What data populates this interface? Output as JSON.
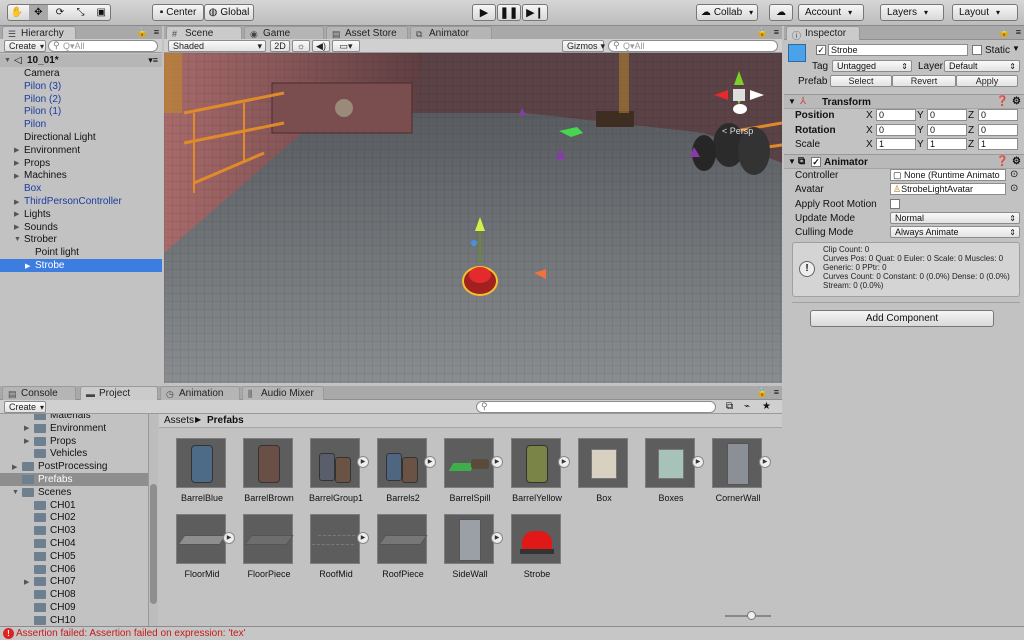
{
  "toolbar": {
    "pivot_center": "Center",
    "pivot_global": "Global",
    "collab": "Collab",
    "account": "Account",
    "layers": "Layers",
    "layout": "Layout"
  },
  "hierarchy": {
    "tab": "Hierarchy",
    "create": "Create",
    "search_placeholder": "Q▾All",
    "scene": "10_01*",
    "items": [
      {
        "label": "Camera",
        "indent": 1,
        "blue": false,
        "arrow": false
      },
      {
        "label": "Pilon (3)",
        "indent": 1,
        "blue": true,
        "arrow": false
      },
      {
        "label": "Pilon (2)",
        "indent": 1,
        "blue": true,
        "arrow": false
      },
      {
        "label": "Pilon (1)",
        "indent": 1,
        "blue": true,
        "arrow": false
      },
      {
        "label": "Pilon",
        "indent": 1,
        "blue": true,
        "arrow": false
      },
      {
        "label": "Directional Light",
        "indent": 1,
        "blue": false,
        "arrow": false
      },
      {
        "label": "Environment",
        "indent": 1,
        "blue": false,
        "arrow": "right"
      },
      {
        "label": "Props",
        "indent": 1,
        "blue": false,
        "arrow": "right"
      },
      {
        "label": "Machines",
        "indent": 1,
        "blue": false,
        "arrow": "right"
      },
      {
        "label": "Box",
        "indent": 1,
        "blue": true,
        "arrow": false
      },
      {
        "label": "ThirdPersonController",
        "indent": 1,
        "blue": true,
        "arrow": "right"
      },
      {
        "label": "Lights",
        "indent": 1,
        "blue": false,
        "arrow": "right"
      },
      {
        "label": "Sounds",
        "indent": 1,
        "blue": false,
        "arrow": "right"
      },
      {
        "label": "Strober",
        "indent": 1,
        "blue": false,
        "arrow": "down"
      },
      {
        "label": "Point light",
        "indent": 2,
        "blue": false,
        "arrow": false
      },
      {
        "label": "Strobe",
        "indent": 2,
        "blue": false,
        "arrow": "right",
        "selected": true
      }
    ]
  },
  "scene": {
    "tabs": [
      "Scene",
      "Game",
      "Asset Store",
      "Animator"
    ],
    "shading": "Shaded",
    "mode2d": "2D",
    "gizmos": "Gizmos",
    "search_placeholder": "Q▾All",
    "persp": "< Persp"
  },
  "inspector": {
    "tab": "Inspector",
    "object_name": "Strobe",
    "static_label": "Static",
    "tag_label": "Tag",
    "tag_value": "Untagged",
    "layer_label": "Layer",
    "layer_value": "Default",
    "prefab_label": "Prefab",
    "prefab_select": "Select",
    "prefab_revert": "Revert",
    "prefab_apply": "Apply",
    "transform": {
      "title": "Transform",
      "position_label": "Position",
      "rotation_label": "Rotation",
      "scale_label": "Scale",
      "position": {
        "x": "0",
        "y": "0",
        "z": "0"
      },
      "rotation": {
        "x": "0",
        "y": "0",
        "z": "0"
      },
      "scale": {
        "x": "1",
        "y": "1",
        "z": "1"
      }
    },
    "animator": {
      "title": "Animator",
      "controller_label": "Controller",
      "controller_value": "None (Runtime Animato",
      "avatar_label": "Avatar",
      "avatar_value": "StrobeLightAvatar",
      "root_motion_label": "Apply Root Motion",
      "update_mode_label": "Update Mode",
      "update_mode_value": "Normal",
      "culling_label": "Culling Mode",
      "culling_value": "Always Animate",
      "info": [
        "Clip Count: 0",
        "Curves Pos: 0 Quat: 0 Euler: 0 Scale: 0 Muscles: 0",
        "Generic: 0 PPtr: 0",
        "Curves Count: 0 Constant: 0 (0.0%) Dense: 0 (0.0%)",
        "Stream: 0 (0.0%)"
      ]
    },
    "add_component": "Add Component"
  },
  "bottom": {
    "tabs": [
      "Console",
      "Project",
      "Animation",
      "Audio Mixer"
    ],
    "create": "Create",
    "breadcrumb_root": "Assets",
    "breadcrumb_current": "Prefabs",
    "tree": [
      {
        "label": "Materials",
        "indent": 2,
        "arrow": false
      },
      {
        "label": "Environment",
        "indent": 2,
        "arrow": "right"
      },
      {
        "label": "Props",
        "indent": 2,
        "arrow": "right"
      },
      {
        "label": "Vehicles",
        "indent": 2,
        "arrow": false
      },
      {
        "label": "PostProcessing",
        "indent": 1,
        "arrow": "right"
      },
      {
        "label": "Prefabs",
        "indent": 1,
        "arrow": false,
        "selected": true
      },
      {
        "label": "Scenes",
        "indent": 1,
        "arrow": "down"
      },
      {
        "label": "CH01",
        "indent": 2,
        "arrow": false
      },
      {
        "label": "CH02",
        "indent": 2,
        "arrow": false
      },
      {
        "label": "CH03",
        "indent": 2,
        "arrow": false
      },
      {
        "label": "CH04",
        "indent": 2,
        "arrow": false
      },
      {
        "label": "CH05",
        "indent": 2,
        "arrow": false
      },
      {
        "label": "CH06",
        "indent": 2,
        "arrow": false
      },
      {
        "label": "CH07",
        "indent": 2,
        "arrow": "right"
      },
      {
        "label": "CH08",
        "indent": 2,
        "arrow": false
      },
      {
        "label": "CH09",
        "indent": 2,
        "arrow": false
      },
      {
        "label": "CH10",
        "indent": 2,
        "arrow": false
      }
    ],
    "assets": [
      {
        "name": "BarrelBlue",
        "play": false,
        "kind": "barrel",
        "color": "#4d6a86"
      },
      {
        "name": "BarrelBrown",
        "play": false,
        "kind": "barrel",
        "color": "#6a4f44"
      },
      {
        "name": "BarrelGroup1",
        "play": true,
        "kind": "barrels",
        "color": "#5a5e6a"
      },
      {
        "name": "Barrels2",
        "play": true,
        "kind": "barrels",
        "color": "#4f6680"
      },
      {
        "name": "BarrelSpill",
        "play": true,
        "kind": "spill",
        "color": "#3fae4a"
      },
      {
        "name": "BarrelYellow",
        "play": true,
        "kind": "barrel",
        "color": "#7a8446"
      },
      {
        "name": "Box",
        "play": false,
        "kind": "box",
        "color": "#d8d1c2"
      },
      {
        "name": "Boxes",
        "play": true,
        "kind": "box",
        "color": "#a7c3b9"
      },
      {
        "name": "CornerWall",
        "play": true,
        "kind": "wall",
        "color": "#8a9096"
      },
      {
        "name": "FloorMid",
        "play": true,
        "kind": "floor",
        "color": "#8e8e8e"
      },
      {
        "name": "FloorPiece",
        "play": false,
        "kind": "floor",
        "color": "#6d6d6d"
      },
      {
        "name": "RoofMid",
        "play": true,
        "kind": "roof",
        "color": "#7a7a7a"
      },
      {
        "name": "RoofPiece",
        "play": false,
        "kind": "floor",
        "color": "#777"
      },
      {
        "name": "SideWall",
        "play": true,
        "kind": "wall",
        "color": "#9aa0a6"
      },
      {
        "name": "Strobe",
        "play": false,
        "kind": "strobe",
        "color": "#e01818"
      }
    ]
  },
  "status": {
    "message": "Assertion failed: Assertion failed on expression: 'tex'"
  }
}
